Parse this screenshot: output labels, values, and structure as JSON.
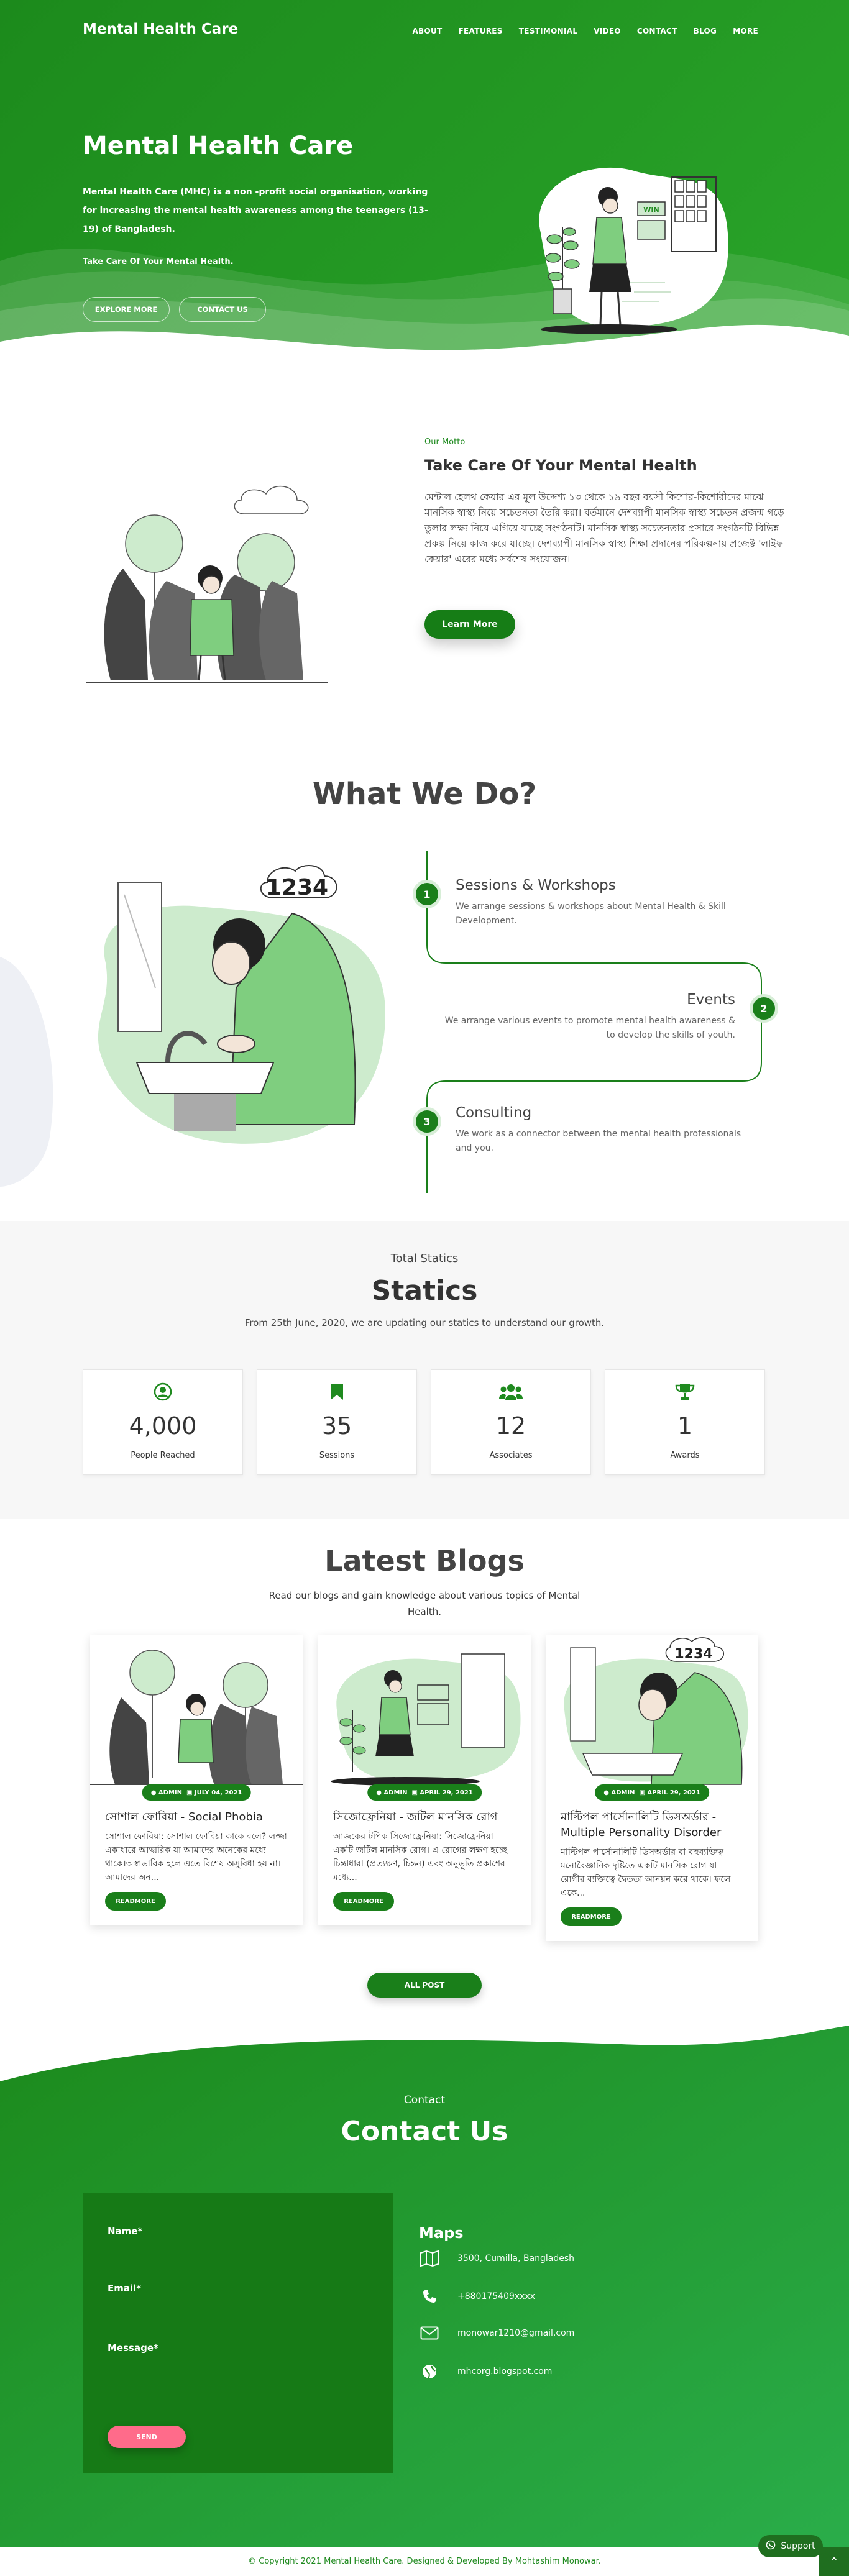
{
  "nav": {
    "brand": "Mental Health Care",
    "items": [
      "ABOUT",
      "FEATURES",
      "TESTIMONIAL",
      "VIDEO",
      "CONTACT",
      "BLOG",
      "MORE"
    ]
  },
  "hero": {
    "title": "Mental Health Care",
    "description": "Mental Health Care (MHC) is a non -profit social organisation, working for increasing the mental health awareness among the teenagers (13-19) of Bangladesh.",
    "tagline": "Take Care Of Your Mental Health.",
    "explore_label": "EXPLORE MORE",
    "contact_label": "CONTACT US",
    "sign_text": "WIN"
  },
  "about": {
    "tag": "Our Motto",
    "title": "Take Care Of Your Mental Health",
    "text": "মেন্টাল হেলথ কেয়ার এর মূল উদ্দেশ্য ১৩ থেকে ১৯ বছর বয়সী কিশোর-কিশোরীদের মাঝে মানসিক স্বাস্থ্য নিয়ে সচেতনতা তৈরি করা। বর্তমানে দেশব্যাপী মানসিক স্বাস্থ্য সচেতন প্রজন্ম গড়ে তুলার লক্ষ্য নিয়ে এগিয়ে যাচ্ছে সংগঠনটি। মানসিক স্বাস্থ্য সচেতনতার প্রসারে সংগঠনটি বিভিন্ন প্রকল্প নিয়ে কাজ করে যাচ্ছে। দেশব্যাপী মানসিক স্বাস্থ্য শিক্ষা প্রদানের পরিকল্পনায় প্রজেক্ট 'লাইফ কেয়ার' এরের মধ্যে সর্বশেষ সংযোজন।",
    "button_label": "Learn More"
  },
  "what_we_do": {
    "title": "What We Do?",
    "board_text": "1234",
    "steps": [
      {
        "num": "1",
        "title": "Sessions & Workshops",
        "desc": "We arrange sessions & workshops about Mental Health & Skill Development."
      },
      {
        "num": "2",
        "title": "Events",
        "desc": "We arrange various events to promote mental health awareness & to develop the skills of youth."
      },
      {
        "num": "3",
        "title": "Consulting",
        "desc": "We work as a connector between the mental health professionals and you."
      }
    ]
  },
  "statics": {
    "tag": "Total Statics",
    "title": "Statics",
    "subtitle": "From 25th June, 2020, we are updating our statics to understand our growth.",
    "cards": [
      {
        "icon": "user-circle-icon",
        "value": "4,000",
        "label": "People Reached"
      },
      {
        "icon": "bookmark-icon",
        "value": "35",
        "label": "Sessions"
      },
      {
        "icon": "users-icon",
        "value": "12",
        "label": "Associates"
      },
      {
        "icon": "trophy-icon",
        "value": "1",
        "label": "Awards"
      }
    ]
  },
  "blogs": {
    "title": "Latest Blogs",
    "subtitle": "Read our blogs and gain knowledge about various topics of Mental Health.",
    "posts": [
      {
        "author": "ADMIN",
        "date": "JULY 04, 2021",
        "title": "সোশাল ফোবিয়া - Social Phobia",
        "excerpt": "সোশাল ফোবিয়া: সোশাল ফোবিয়া কাকে বলে? লজ্জা একাধারে আত্মরিক যা আমাদের অনেকের মধ্যে থাকে।অস্বাভাবিক হলে এতে বিশেষ অসুবিধা হয় না। আমাদের অন...",
        "button": "READMORE"
      },
      {
        "author": "ADMIN",
        "date": "APRIL 29, 2021",
        "title": "সিজোফ্রেনিয়া - জটিল মানসিক রোগ",
        "excerpt": "আজকের টপিক সিজোফ্রেনিয়া: সিজোফ্রেনিয়া একটি জটিল মানসিক রোগ। এ রোগের লক্ষণ হচ্ছে চিন্তাধারা (প্রত্যক্ষণ, চিন্তন) এবং অনুভূতি প্রকাশের মধ্যে...",
        "button": "READMORE"
      },
      {
        "author": "ADMIN",
        "date": "APRIL 29, 2021",
        "title": "মাল্টিপল পার্সোনালিটি ডিসঅর্ডার - Multiple Personality Disorder",
        "excerpt": "মাল্টিপল পার্সোনালিটি ডিসঅর্ডার বা বহুব্যক্তিত্ব মনোবৈজ্ঞানিক দৃষ্টিতে একটি মানসিক রোগ যা রোগীর ব্যক্তিত্বে দ্বৈততা আনয়ন করে থাকে। ফলে একে...",
        "button": "READMORE"
      }
    ],
    "all_post_label": "ALL POST"
  },
  "contact": {
    "tag": "Contact",
    "title": "Contact Us",
    "form": {
      "name_label": "Name*",
      "email_label": "Email*",
      "message_label": "Message*",
      "send_label": "SEND"
    },
    "maps": {
      "title": "Maps",
      "address": "3500, Cumilla, Bangladesh",
      "phone": "+880175409xxxx",
      "email": "monowar1210@gmail.com",
      "website": "mhcorg.blogspot.com"
    }
  },
  "footer": {
    "text": "© Copyright 2021 Mental Health Care. Designed & Developed By Mohtashim Monowar.",
    "support_label": "Support"
  }
}
